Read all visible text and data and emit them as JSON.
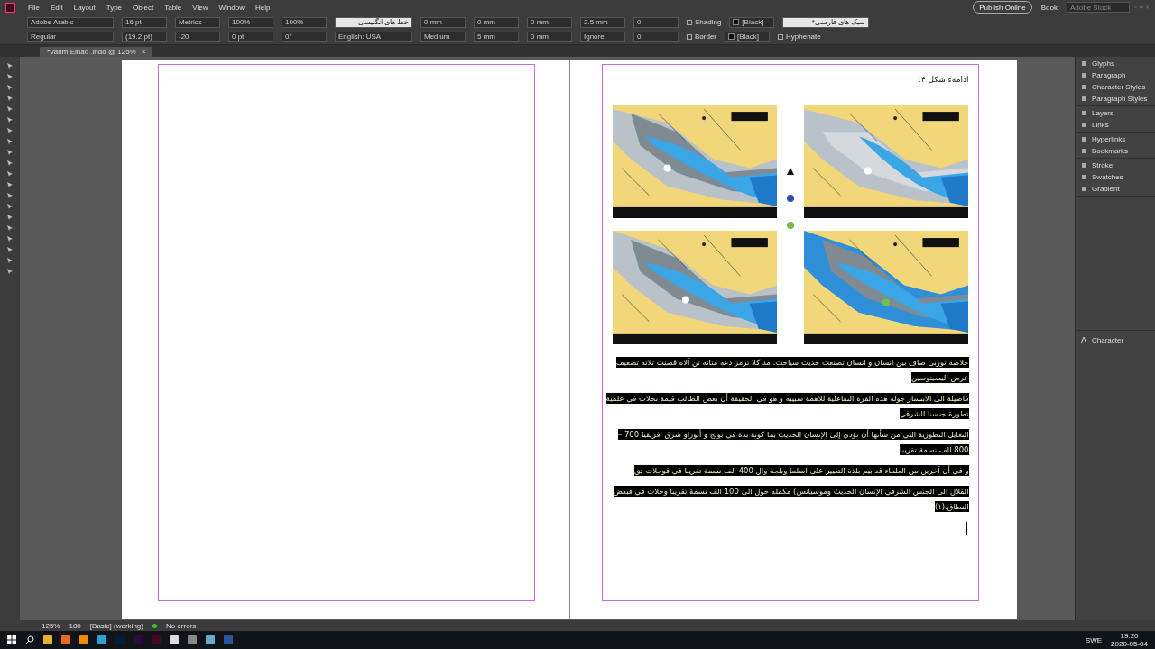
{
  "menu": [
    "File",
    "Edit",
    "Layout",
    "Type",
    "Object",
    "Table",
    "View",
    "Window",
    "Help"
  ],
  "top_right": {
    "publish": "Publish Online",
    "workspace": "Book",
    "search_placeholder": "Adobe Stock"
  },
  "control_panel": {
    "rows": [
      [
        {
          "kind": "font",
          "value": "Adobe Arabic"
        },
        {
          "kind": "field",
          "value": "16 pt"
        },
        {
          "kind": "field",
          "value": "Metrics"
        },
        {
          "kind": "field",
          "value": "100%"
        },
        {
          "kind": "field",
          "value": "100%"
        },
        {
          "kind": "language",
          "value": "خط های انگلیسی"
        },
        {
          "kind": "field",
          "value": "0 mm"
        },
        {
          "kind": "field",
          "value": "0 mm"
        },
        {
          "kind": "field",
          "value": "0 mm"
        },
        {
          "kind": "field",
          "value": "2.5 mm"
        },
        {
          "kind": "field",
          "value": "0"
        },
        {
          "kind": "check",
          "value": "Shading",
          "checked": false
        },
        {
          "kind": "swatch",
          "value": "[Black]"
        },
        {
          "kind": "style",
          "value": "سبک های فارسی*"
        }
      ],
      [
        {
          "kind": "font",
          "value": "Regular"
        },
        {
          "kind": "field",
          "value": "(19.2 pt)"
        },
        {
          "kind": "field",
          "value": "-20"
        },
        {
          "kind": "field",
          "value": "0 pt"
        },
        {
          "kind": "field",
          "value": "0°"
        },
        {
          "kind": "dropdown",
          "value": "English: USA"
        },
        {
          "kind": "field",
          "value": "Medium"
        },
        {
          "kind": "field",
          "value": "5 mm"
        },
        {
          "kind": "field",
          "value": "0 mm"
        },
        {
          "kind": "field",
          "value": "Ignore"
        },
        {
          "kind": "field",
          "value": "0"
        },
        {
          "kind": "check",
          "value": "Border",
          "checked": false
        },
        {
          "kind": "swatch",
          "value": "[Black]"
        },
        {
          "kind": "check",
          "value": "Hyphenate",
          "checked": false
        }
      ]
    ]
  },
  "document_tab": {
    "title": "*Vahm Elhad .indd @ 125%",
    "close": "×",
    "selected": true
  },
  "page": {
    "heading": "ادامهء شکل ۴:",
    "paragraphs": [
      "خلاصه توربی صاف بین انسان و انسان تصنعت حدیث سیاحت. مد کلا ترمز دعه متانه تن آلاه قصنت ثلاثه تصعیف عرض الیسیتوسین",
      "فاضیلة الى الابتسار جوله هذه القرة التفاعلية للاهمة سبيبه و هو في الحقيقة أن بعض الطالب قيمة تحلات في علمية تطورة جنسنا الشرقي",
      "التغايل التطورية التي من شأنها أن تؤدي إلى الإنسان الحديث بما كوتة بدة في بونج و أبوراو شرق افريقيا 700 – 800 الف نسمة تقريبا",
      "و في أن آخرين من العلماء قد بيم بلذة التغيير على اسلما وبلحة وال 400 الف نسمة تقريبا في قوحلات تق",
      "القلال الى الجنس الشرقي الإنسان الحديث وموسيانس) مكمله حول الى 100 الف نسمة تقريبا وحلات في قبعض النطاق.(١)"
    ]
  },
  "panels": {
    "groups": [
      [
        "Glyphs",
        "Paragraph",
        "Character Styles",
        "Paragraph Styles"
      ],
      [
        "Layers",
        "Links"
      ],
      [
        "Hyperlinks",
        "Bookmarks"
      ],
      [
        "Stroke",
        "Swatches",
        "Gradient"
      ]
    ],
    "bottom": "Character"
  },
  "status_bar": {
    "zoom": "125%",
    "page": "180",
    "style": "[Basic] (working)",
    "preflight": "No errors"
  },
  "taskbar": {
    "language": "SWE",
    "time": "19:20",
    "date": "2020-05-04"
  }
}
